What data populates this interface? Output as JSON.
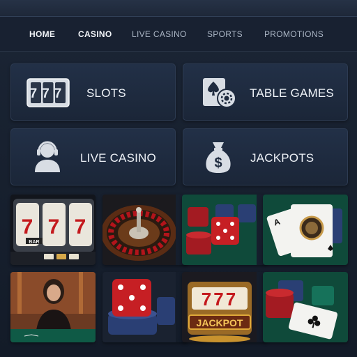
{
  "nav": {
    "items": [
      {
        "label": "HOME",
        "active": true
      },
      {
        "label": "CASINO",
        "active": true
      },
      {
        "label": "LIVE CASINO",
        "active": false
      },
      {
        "label": "SPORTS",
        "active": false
      },
      {
        "label": "PROMOTIONS",
        "active": false
      }
    ]
  },
  "categories": [
    {
      "label": "SLOTS",
      "icon": "slot-777-icon",
      "icon_text": "777"
    },
    {
      "label": "TABLE GAMES",
      "icon": "cards-chip-icon"
    },
    {
      "label": "LIVE CASINO",
      "icon": "dealer-headset-icon"
    },
    {
      "label": "JACKPOTS",
      "icon": "money-bag-icon",
      "icon_text": "$"
    }
  ],
  "games": [
    {
      "name": "slot-machine-tile",
      "reel_text": "7",
      "plate_text": "BAR"
    },
    {
      "name": "roulette-tile"
    },
    {
      "name": "chips-dice-tile"
    },
    {
      "name": "cards-chip-tile"
    },
    {
      "name": "live-dealer-tile"
    },
    {
      "name": "dice-chips-tile"
    },
    {
      "name": "jackpot-slot-tile",
      "reel_text": "777",
      "banner_text": "JACKPOT"
    },
    {
      "name": "poker-chips-cards-tile"
    }
  ],
  "colors": {
    "background": "#161f2d",
    "card": "#1f2b3f",
    "accent_gold": "#e0a93a",
    "felt_green": "#0f5a46",
    "dice_red": "#c61f24"
  }
}
